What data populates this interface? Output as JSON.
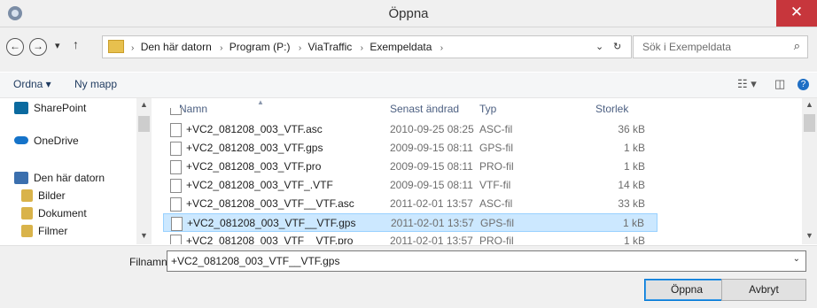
{
  "window": {
    "title": "Öppna",
    "close_symbol": "✕"
  },
  "nav": {
    "back": "←",
    "forward": "→",
    "dropdown": "▾",
    "up": "↑"
  },
  "address": {
    "crumbs": [
      "Den här datorn",
      "Program (P:)",
      "ViaTraffic",
      "Exempeldata"
    ],
    "separator": "›",
    "dropdown": "⌄",
    "refresh": "↻"
  },
  "search": {
    "placeholder": "Sök i Exempeldata",
    "icon": "⌕"
  },
  "toolbar": {
    "organize": "Ordna ▾",
    "new_folder": "Ny mapp",
    "view_symbol": "☷ ▾",
    "pane_symbol": "◫",
    "help_symbol": "?"
  },
  "sidebar": {
    "items": [
      {
        "label": "SharePoint",
        "icon": "sharepoint-icon",
        "color": "#0b6a9f"
      },
      {
        "label": "OneDrive",
        "icon": "onedrive-icon",
        "color": "#1573c9"
      },
      {
        "label": "Den här datorn",
        "icon": "computer-icon",
        "color": "#3b6fae"
      },
      {
        "label": "Bilder",
        "icon": "pictures-icon",
        "color": "#d9b34a"
      },
      {
        "label": "Dokument",
        "icon": "documents-icon",
        "color": "#d9b34a"
      },
      {
        "label": "Filmer",
        "icon": "videos-icon",
        "color": "#d9b34a"
      }
    ]
  },
  "columns": {
    "name": "Namn",
    "date": "Senast ändrad",
    "type": "Typ",
    "size": "Storlek"
  },
  "files": [
    {
      "name": "+VC2_081208_003_VTF.asc",
      "date": "2010-09-25 08:25",
      "type": "ASC-fil",
      "size": "36 kB"
    },
    {
      "name": "+VC2_081208_003_VTF.gps",
      "date": "2009-09-15 08:11",
      "type": "GPS-fil",
      "size": "1 kB"
    },
    {
      "name": "+VC2_081208_003_VTF.pro",
      "date": "2009-09-15 08:11",
      "type": "PRO-fil",
      "size": "1 kB"
    },
    {
      "name": "+VC2_081208_003_VTF_.VTF",
      "date": "2009-09-15 08:11",
      "type": "VTF-fil",
      "size": "14 kB"
    },
    {
      "name": "+VC2_081208_003_VTF__VTF.asc",
      "date": "2011-02-01 13:57",
      "type": "ASC-fil",
      "size": "33 kB"
    },
    {
      "name": "+VC2_081208_003_VTF__VTF.gps",
      "date": "2011-02-01 13:57",
      "type": "GPS-fil",
      "size": "1 kB",
      "selected": true
    },
    {
      "name": "+VC2_081208_003_VTF__VTF.pro",
      "date": "2011-02-01 13:57",
      "type": "PRO-fil",
      "size": "1 kB"
    }
  ],
  "filename": {
    "label": "Filnamn:",
    "value": "+VC2_081208_003_VTF__VTF.gps",
    "dropdown": "⌄"
  },
  "buttons": {
    "open": "Öppna",
    "cancel": "Avbryt"
  },
  "colors": {
    "selection": "#cce8ff",
    "close": "#c7363c",
    "accent": "#0078d7"
  }
}
